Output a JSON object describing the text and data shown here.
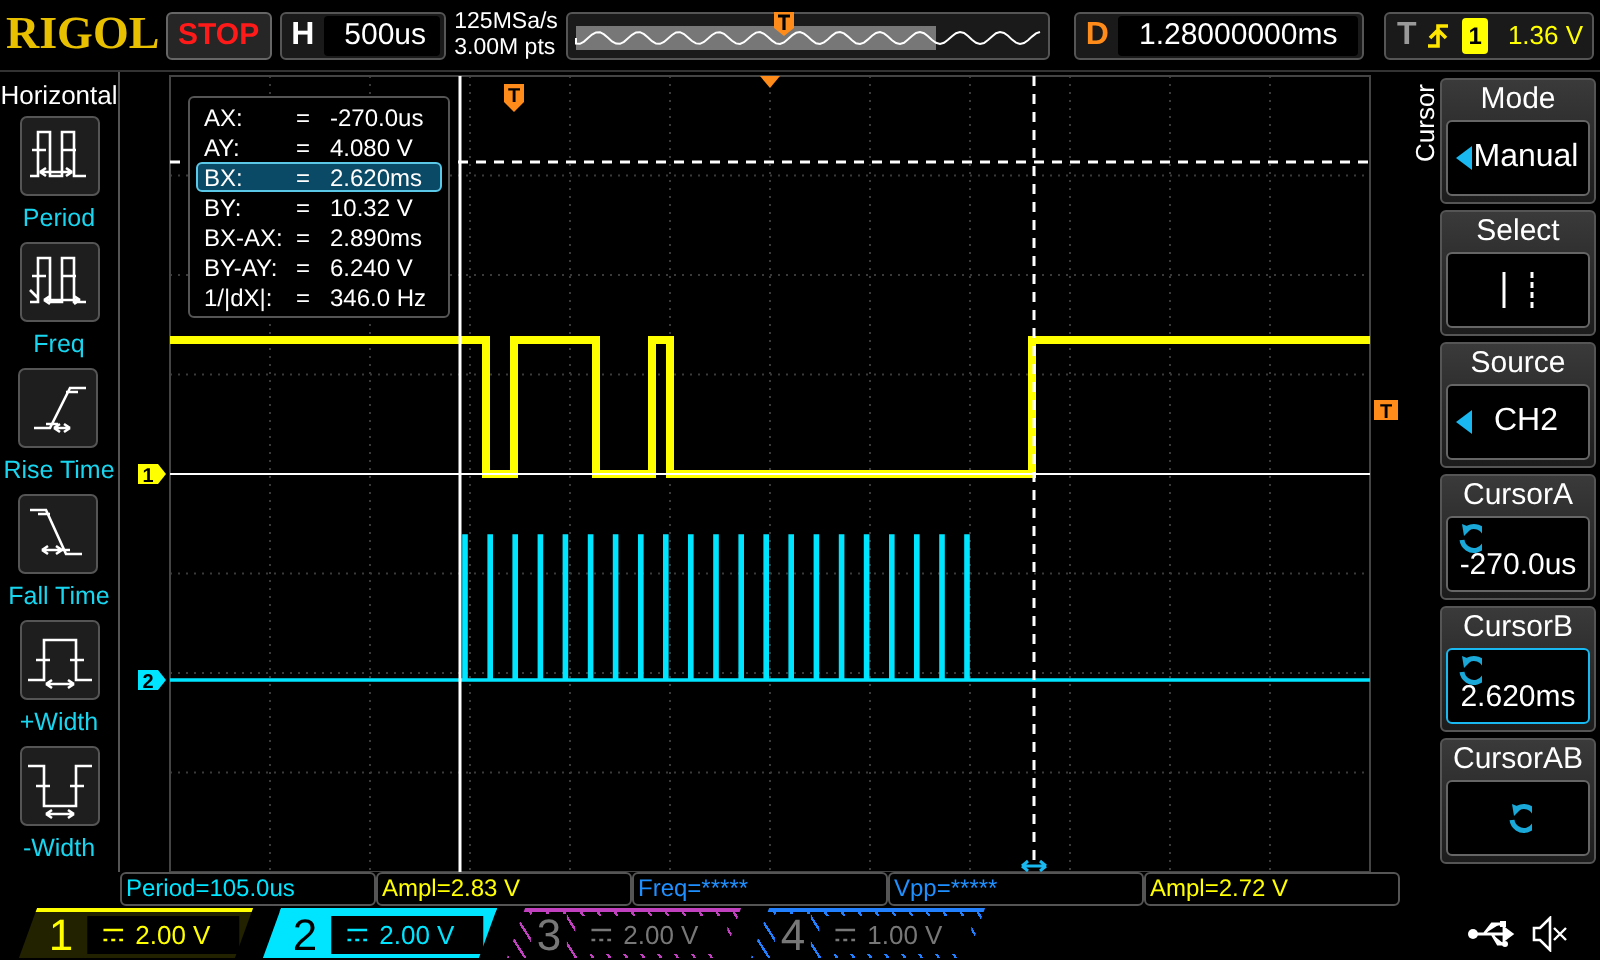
{
  "brand": "RIGOL",
  "run_state": {
    "label": "STOP",
    "kind": "stop"
  },
  "timebase": {
    "label": "H",
    "value": "500us"
  },
  "acquisition": {
    "sample_rate": "125MSa/s",
    "memory_depth": "3.00M pts"
  },
  "delay": {
    "label": "D",
    "value": "1.28000000ms"
  },
  "trigger": {
    "label": "T",
    "source": "1",
    "level": "1.36 V"
  },
  "left_menu": {
    "title": "Horizontal",
    "items": [
      {
        "label": "Period",
        "kind": "period"
      },
      {
        "label": "Freq",
        "kind": "freq"
      },
      {
        "label": "Rise Time",
        "kind": "rise"
      },
      {
        "label": "Fall Time",
        "kind": "fall"
      },
      {
        "label": "+Width",
        "kind": "pwidth"
      },
      {
        "label": "-Width",
        "kind": "nwidth"
      }
    ]
  },
  "cursor_readout": [
    {
      "name": "AX:",
      "separator": "=",
      "value": "-270.0us",
      "selected": false
    },
    {
      "name": "AY:",
      "separator": "=",
      "value": "4.080 V",
      "selected": false
    },
    {
      "name": "BX:",
      "separator": "=",
      "value": "2.620ms",
      "selected": true
    },
    {
      "name": "BY:",
      "separator": "=",
      "value": "10.32 V",
      "selected": false
    },
    {
      "name": "BX-AX:",
      "separator": "=",
      "value": "2.890ms",
      "selected": false
    },
    {
      "name": "BY-AY:",
      "separator": "=",
      "value": "6.240 V",
      "selected": false
    },
    {
      "name": "1/|dX|:",
      "separator": "=",
      "value": "346.0 Hz",
      "selected": false
    }
  ],
  "display_markers": {
    "channel_1": "1",
    "channel_2": "2",
    "trigger_position": "T",
    "trigger_level": "T"
  },
  "right_menu": {
    "title": "Cursor",
    "items": [
      {
        "title": "Mode",
        "kind": "select",
        "value": "Manual",
        "selected": false
      },
      {
        "title": "Select",
        "kind": "pair",
        "selected": false
      },
      {
        "title": "Source",
        "kind": "select",
        "value": "CH2",
        "selected": false
      },
      {
        "title": "CursorA",
        "kind": "knob",
        "value": "-270.0us",
        "selected": false
      },
      {
        "title": "CursorB",
        "kind": "knob",
        "value": "2.620ms",
        "selected": true
      },
      {
        "title": "CursorAB",
        "kind": "knob",
        "selected": false
      }
    ]
  },
  "measurements": [
    {
      "text": "Period=105.0us",
      "color": "#00e5ff"
    },
    {
      "text": "Ampl=2.83 V",
      "color": "#ffff00"
    },
    {
      "text": "Freq=*****",
      "color": "#1e90ff"
    },
    {
      "text": "Vpp=*****",
      "color": "#1e90ff"
    },
    {
      "text": "Ampl=2.72 V",
      "color": "#ffff00"
    }
  ],
  "channels": [
    {
      "number": "1",
      "scale": "2.00 V",
      "color": "#ffff00",
      "on": true,
      "selected": false
    },
    {
      "number": "2",
      "scale": "2.00 V",
      "color": "#00e5ff",
      "on": true,
      "selected": true
    },
    {
      "number": "3",
      "scale": "2.00 V",
      "color": "#c040c0",
      "on": false,
      "selected": false
    },
    {
      "number": "4",
      "scale": "1.00 V",
      "color": "#2080ff",
      "on": false,
      "selected": false
    }
  ]
}
